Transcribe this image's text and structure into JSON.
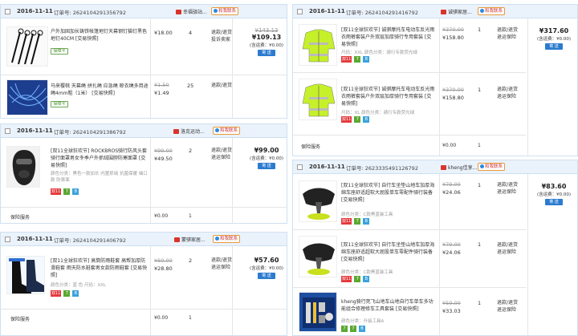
{
  "orders": [
    {
      "date": "2016-11-11",
      "order_label": "订单号:",
      "order_no": "2624104291356792",
      "shop": "幸福驿站...",
      "contact": "和我联系",
      "total_old": "¥143.13",
      "total": "¥109.13",
      "shipping": "(含运费：¥0.00)",
      "btn": "寄 送",
      "items": [
        {
          "title": "户外加固加长铸铁帐篷地钉天幕钢钉猫钉黑色地钉40CM [交易快照]",
          "badge": "保障卡",
          "old_price": "",
          "price": "¥18.00",
          "qty": "4",
          "after": "退款/退货",
          "after2": "投诉卖家"
        },
        {
          "title": "马来樱桃 天幕绳 拼扎绳 应急绳 晾衣绳多用途绳4mm粗（1米） [交易快照]",
          "badge": "保障卡",
          "old_price": "¥1.50",
          "price": "¥1.49",
          "qty": "25",
          "after": "退款/退货",
          "after2": ""
        }
      ]
    },
    {
      "date": "2016-11-11",
      "order_label": "订单号:",
      "order_no": "2624104291416792",
      "shop": "诚骐家居...",
      "contact": "和我联系",
      "total_old": "",
      "total": "¥317.60",
      "shipping": "(含运费：¥0.00)",
      "btn": "寄 送",
      "items": [
        {
          "title": "[双11全球狂欢节] 诚骐摩托车电动车反光雨衣雨裤套装户外双层加厚骑行专用套装 [交易快照]",
          "spec": "尺码：XXL  颜色分类：骑行专款荧光绿",
          "old_price": "¥370.00",
          "price": "¥158.80",
          "qty": "1",
          "after": "退款/退货",
          "after2": "退运保险"
        },
        {
          "title": "[双11全球狂欢节] 诚骐摩托车电动车反光雨衣雨裤套装户外双层加厚骑行专用套装 [交易快照]",
          "spec": "尺码：XL  颜色分类：骑行专款荧光绿",
          "old_price": "¥370.00",
          "price": "¥158.80",
          "qty": "1",
          "after": "退款/退货",
          "after2": "退运保险"
        }
      ],
      "fee_label": "保险服务",
      "fee_price": "¥0.00",
      "fee_qty": "1"
    },
    {
      "date": "2016-11-11",
      "order_label": "订单号:",
      "order_no": "2624104291386792",
      "shop": "洛克运动...",
      "contact": "和我联系",
      "total_old": "",
      "total": "¥99.00",
      "shipping": "(含运费：¥0.00)",
      "btn": "寄 送",
      "items": [
        {
          "title": "[双11全球狂欢节] ROCKBROS骑行防风头套骑行面罩男女冬季户外抓绒围脖防寒面罩 [交易快照]",
          "spec": "颜色分类：黑色一款加长 内置抓绒 抗菌保暖 袖口款 防寒面",
          "old_price": "¥99.00",
          "price": "¥49.50",
          "qty": "2",
          "after": "退款/退货",
          "after2": "退运保险"
        }
      ],
      "fee_label": "保险服务",
      "fee_price": "¥0.00",
      "fee_qty": "1"
    },
    {
      "date": "2016-11-11",
      "order_label": "订单号:",
      "order_no": "2623335491126792",
      "shop": "kheng佳享...",
      "contact": "和我联系",
      "total_old": "",
      "total": "¥83.60",
      "shipping": "(含运费：¥0.00)",
      "btn": "寄 送",
      "items": [
        {
          "title": "[双11全球狂欢节] 自行车坐垫山地车加厚海绵车座舒适超软大屁股单车零配件骑行装备 [交易快照]",
          "spec": "颜色分类：C款黑蓝装工具",
          "old_price": "¥79.00",
          "price": "¥24.06",
          "qty": "1",
          "after": "退款/退货",
          "after2": "退运保险"
        },
        {
          "title": "[双11全球狂欢节] 自行车坐垫山地车加厚海绵车座舒适超软大屁股单车零配件骑行装备 [交易快照]",
          "spec": "颜色分类：C款黑蓝装工具",
          "old_price": "¥79.00",
          "price": "¥24.06",
          "qty": "1",
          "after": "退款/退货",
          "after2": "退运保险"
        },
        {
          "title": "kheng骑行死飞山地车山地自行车单车多功能组合修理修车工具套装 [交易快照]",
          "spec": "颜色分类：升级工具A",
          "old_price": "¥59.00",
          "price": "¥33.03",
          "qty": "1",
          "after": "退款/退货",
          "after2": "退运保险"
        }
      ]
    },
    {
      "date": "2016-11-11",
      "order_label": "订单号:",
      "order_no": "2624104291406792",
      "shop": "蒙骐家居...",
      "contact": "和我联系",
      "total_old": "",
      "total": "¥57.60",
      "shipping": "(含运费：¥0.00)",
      "btn": "寄 送",
      "items": [
        {
          "title": "[双11全球狂欢节] 高筒防雨鞋套 高帮加厚防滑鞋套 雨天防水鞋套男女款防雨鞋套 [交易快照]",
          "spec": "颜色分类：蓝 色  尺码：XXL",
          "old_price": "¥60.00",
          "price": "¥28.80",
          "qty": "2",
          "after": "退款/退货",
          "after2": "退运保险"
        }
      ],
      "fee_label": "保险服务",
      "fee_price": "¥0.00",
      "fee_qty": "1"
    }
  ],
  "tag_labels": {
    "t11": "双11",
    "tg": "7",
    "tb": "B"
  },
  "icons": {
    "shop": "shop-icon",
    "contact": "chat-icon"
  },
  "colors": {
    "header_bg": "#eaf2fb",
    "accent_red": "#e4393c",
    "btn_blue": "#2b7bd0"
  }
}
